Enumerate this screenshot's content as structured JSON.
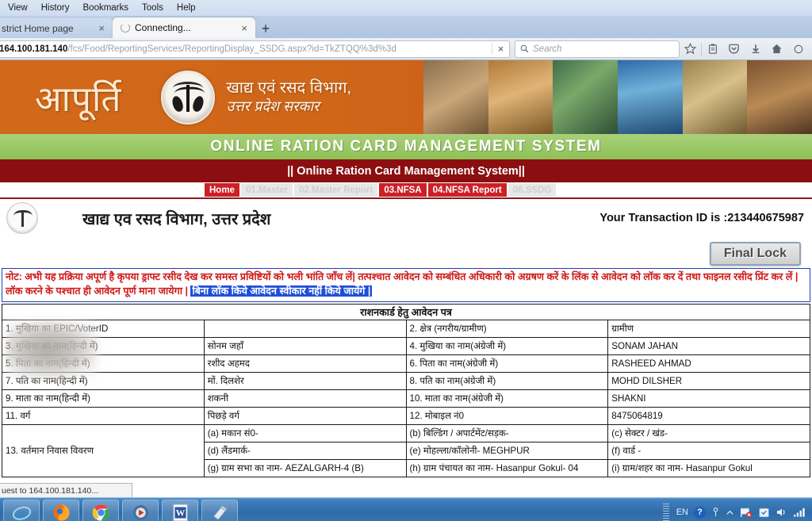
{
  "browser": {
    "menu_items": [
      "View",
      "History",
      "Bookmarks",
      "Tools",
      "Help"
    ],
    "tabs": [
      {
        "label": "strict Home page",
        "state": "inactive",
        "close": "×"
      },
      {
        "label": "Connecting...",
        "state": "active",
        "close": "×"
      }
    ],
    "new_tab_label": "+",
    "url_host": "164.100.181.140",
    "url_path": "/fcs/Food/ReportingServices/ReportingDisplay_SSDG.aspx?id=TkZTQQ%3d%3d",
    "stop_label": "×",
    "search_placeholder": "Search",
    "toolbar_icons": [
      "bookmark-star-icon",
      "reader-clipboard-icon",
      "pocket-icon",
      "downloads-icon",
      "home-icon"
    ]
  },
  "site": {
    "brand_hindi": "आपूर्ति",
    "dept_line1": "खाद्य एवं रसद विभाग,",
    "dept_line2": "उत्तर प्रदेश सरकार",
    "green_bar": "ONLINE  RATION  CARD  MANAGEMENT  SYSTEM",
    "red_bar": "|| Online Ration Card Management System||",
    "accent_orange": "#cf6518",
    "accent_green": "#8fc155",
    "accent_red": "#8b0f10",
    "accent_tab_red": "#cc2026"
  },
  "nav": {
    "items": [
      {
        "label": "Home",
        "active": true
      },
      {
        "label": "01.Master",
        "active": false
      },
      {
        "label": "02.Master Report",
        "active": false
      },
      {
        "label": "03.NFSA",
        "active": true
      },
      {
        "label": "04.NFSA Report",
        "active": true
      },
      {
        "label": "06.SSDG",
        "active": false
      }
    ]
  },
  "document": {
    "title": "खाद्य एव रसद विभाग, उत्तर प्रदेश",
    "transaction_label": "Your Transaction ID is :213440675987",
    "final_lock_button": "Final Lock",
    "notice_line1": "नोट: अभी यह प्रक्रिया अपूर्ण है कृपया ड्राफ्ट रसीद देख कर समस्त प्रविष्टियों को भली भांति जाँच लें| तत्पश्चात आवेदन को सम्बंधित अधिकारी को अग्रषण करें के लिंक से आवेदन",
    "notice_line2": "को लॉक कर दें तथा फाइनल रसीद प्रिंट कर लें | लॉक करने के पश्चात ही आवेदन पूर्ण माना जायेगा |",
    "notice_highlight": "बिना लॉक किये आवेदन स्वीकार नहीं किये जायेंगे |",
    "form_title": "राशनकार्ड हेतु आवेदन पत्र",
    "rows": [
      {
        "left_label": "1. मुखिया का EPIC/VoterID",
        "left_value": "",
        "right_label": "2. क्षेत्र (नगरीय/ग्रामीण)",
        "right_value": "ग्रामीण"
      },
      {
        "left_label": "3. मुखिया का नाम(हिन्दी में)",
        "left_value": "सोनम जहाँ",
        "right_label": "4. मुखिया का नाम(अंग्रेजी में)",
        "right_value": "SONAM JAHAN"
      },
      {
        "left_label": "5. पिता का नाम(हिन्दी में)",
        "left_value": "रशीद अहमद",
        "right_label": "6. पिता का नाम(अंग्रेजी में)",
        "right_value": "RASHEED AHMAD"
      },
      {
        "left_label": "7. पति का नाम(हिन्दी में)",
        "left_value": "मों. दिलशेर",
        "right_label": "8. पति का नाम(अंग्रेजी में)",
        "right_value": " MOHD DILSHER"
      },
      {
        "left_label": "9. माता का नाम(हिन्दी में)",
        "left_value": "शकनी",
        "right_label": "10. माता का नाम(अंग्रेजी में)",
        "right_value": "SHAKNI"
      },
      {
        "left_label": "11. वर्ग",
        "left_value": "पिछड़े वर्ग",
        "right_label": "12. मोबाइल नं0",
        "right_value": "8475064819"
      },
      {
        "left_label": "13. वर्तमान निवास विवरण",
        "left_value": "(a) मकान सं0-",
        "right_label": "(b) बिल्डिंग / अपार्टमेंट/सड़क-",
        "right_value": "(c) सेक्टर / खंड-"
      },
      {
        "left_label": "",
        "left_value": "(d) लैंडमार्क-",
        "right_label": "(e) मोहल्ला/कॉलोनी- MEGHPUR",
        "right_value": "(f) वार्ड -"
      },
      {
        "left_label": "",
        "left_value": "(g) ग्राम सभा का नाम- AEZALGARH-4 (B)",
        "right_label": "(h) ग्राम पंचायत का नाम- Hasanpur Gokul- 04",
        "right_value": "(i) ग्राम/शहर का नाम- Hasanpur Gokul"
      }
    ]
  },
  "status_bar": {
    "text": "uest to 164.100.181.140..."
  },
  "taskbar": {
    "apps": [
      {
        "name": "internet-explorer-icon",
        "glyph": "e"
      },
      {
        "name": "firefox-icon",
        "glyph": ""
      },
      {
        "name": "chrome-icon",
        "glyph": ""
      },
      {
        "name": "media-player-icon",
        "glyph": ""
      },
      {
        "name": "word-icon",
        "glyph": "W"
      },
      {
        "name": "notepad-icon",
        "glyph": ""
      }
    ],
    "language": "EN",
    "help_glyph": "?",
    "tray_icons": [
      "flag-alert-icon",
      "action-center-icon",
      "volume-icon",
      "network-icon"
    ]
  }
}
